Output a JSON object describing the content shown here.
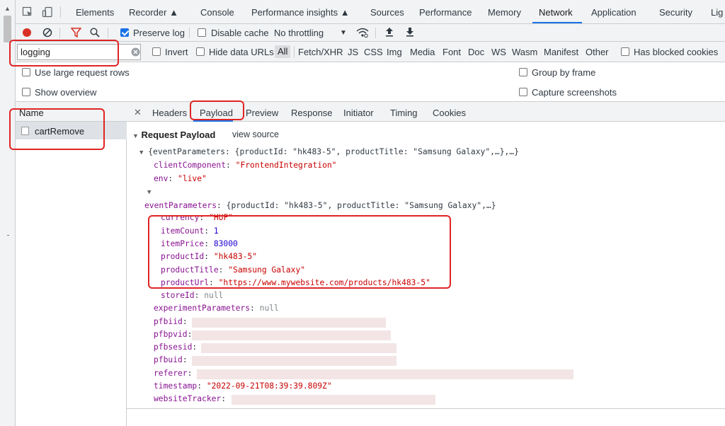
{
  "tabs": [
    "Elements",
    "Recorder",
    "Console",
    "Performance insights",
    "Sources",
    "Performance",
    "Memory",
    "Network",
    "Application",
    "Security",
    "Lig"
  ],
  "active_tab": "Network",
  "toolbar": {
    "preserve_log": "Preserve log",
    "disable_cache": "Disable cache",
    "throttling": "No throttling"
  },
  "filter": {
    "value": "logging",
    "invert": "Invert",
    "hide_data_urls": "Hide data URLs",
    "types": [
      "All",
      "Fetch/XHR",
      "JS",
      "CSS",
      "Img",
      "Media",
      "Font",
      "Doc",
      "WS",
      "Wasm",
      "Manifest",
      "Other"
    ],
    "has_blocked": "Has blocked cookies"
  },
  "options": {
    "large_rows": "Use large request rows",
    "group_by_frame": "Group by frame",
    "show_overview": "Show overview",
    "capture_screenshots": "Capture screenshots"
  },
  "requests": {
    "header": "Name",
    "items": [
      "cartRemove"
    ]
  },
  "detail_tabs": [
    "Headers",
    "Payload",
    "Preview",
    "Response",
    "Initiator",
    "Timing",
    "Cookies"
  ],
  "payload": {
    "section_title": "Request Payload",
    "view_source": "view source",
    "summary": "{eventParameters: {productId: \"hk483-5\", productTitle: \"Samsung Galaxy\",…},…}",
    "client_component": "\"FrontendIntegration\"",
    "env": "\"live\"",
    "event_params_summary": "{productId: \"hk483-5\", productTitle: \"Samsung Galaxy\",…}",
    "currency": "\"HUF\"",
    "itemCount": "1",
    "itemPrice": "83000",
    "productId": "\"hk483-5\"",
    "productTitle": "\"Samsung Galaxy\"",
    "productUrl": "\"https://www.mywebsite.com/products/hk483-5\"",
    "storeId": "null",
    "experimentParameters": "null",
    "timestamp": "\"2022-09-21T08:39:39.809Z\""
  },
  "colors": {
    "accent": "#1a73e8",
    "annotation": "#e02424",
    "key": "#881391",
    "string": "#c80000",
    "number": "#1c00cf"
  }
}
